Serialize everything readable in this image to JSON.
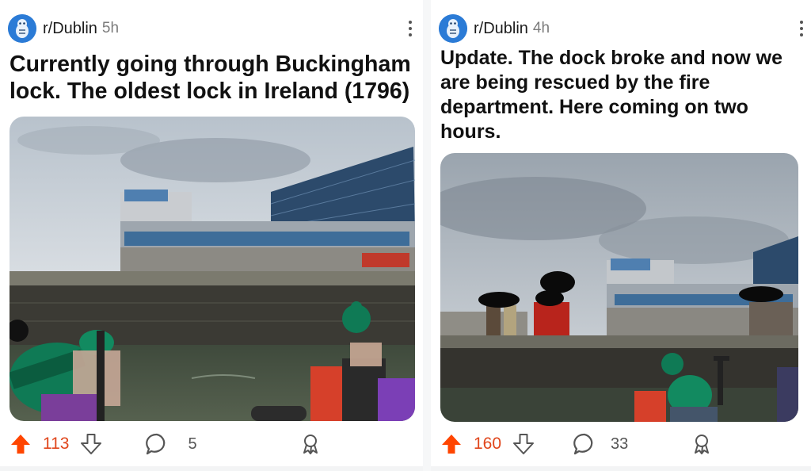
{
  "posts": [
    {
      "subreddit": "r/Dublin",
      "age": "5h",
      "title": "Currently going through Buckingham lock. The oldest lock in Ireland (1796)",
      "score": "113",
      "comments": "5",
      "icons": [
        "subreddit-avatar-icon",
        "more-options-icon",
        "upvote-icon",
        "downvote-icon",
        "comment-icon",
        "award-icon"
      ]
    },
    {
      "subreddit": "r/Dublin",
      "age": "4h",
      "title": "Update. The dock broke and now we are being rescued by the fire department. Here coming on two hours.",
      "score": "160",
      "comments": "33",
      "icons": [
        "subreddit-avatar-icon",
        "more-options-icon",
        "upvote-icon",
        "downvote-icon",
        "comment-icon",
        "award-icon"
      ]
    }
  ],
  "colors": {
    "upvote_active": "#ff4500",
    "score_text": "#e0461c",
    "avatar_bg": "#2b7bd6",
    "meta_text": "#7c7c7c"
  }
}
